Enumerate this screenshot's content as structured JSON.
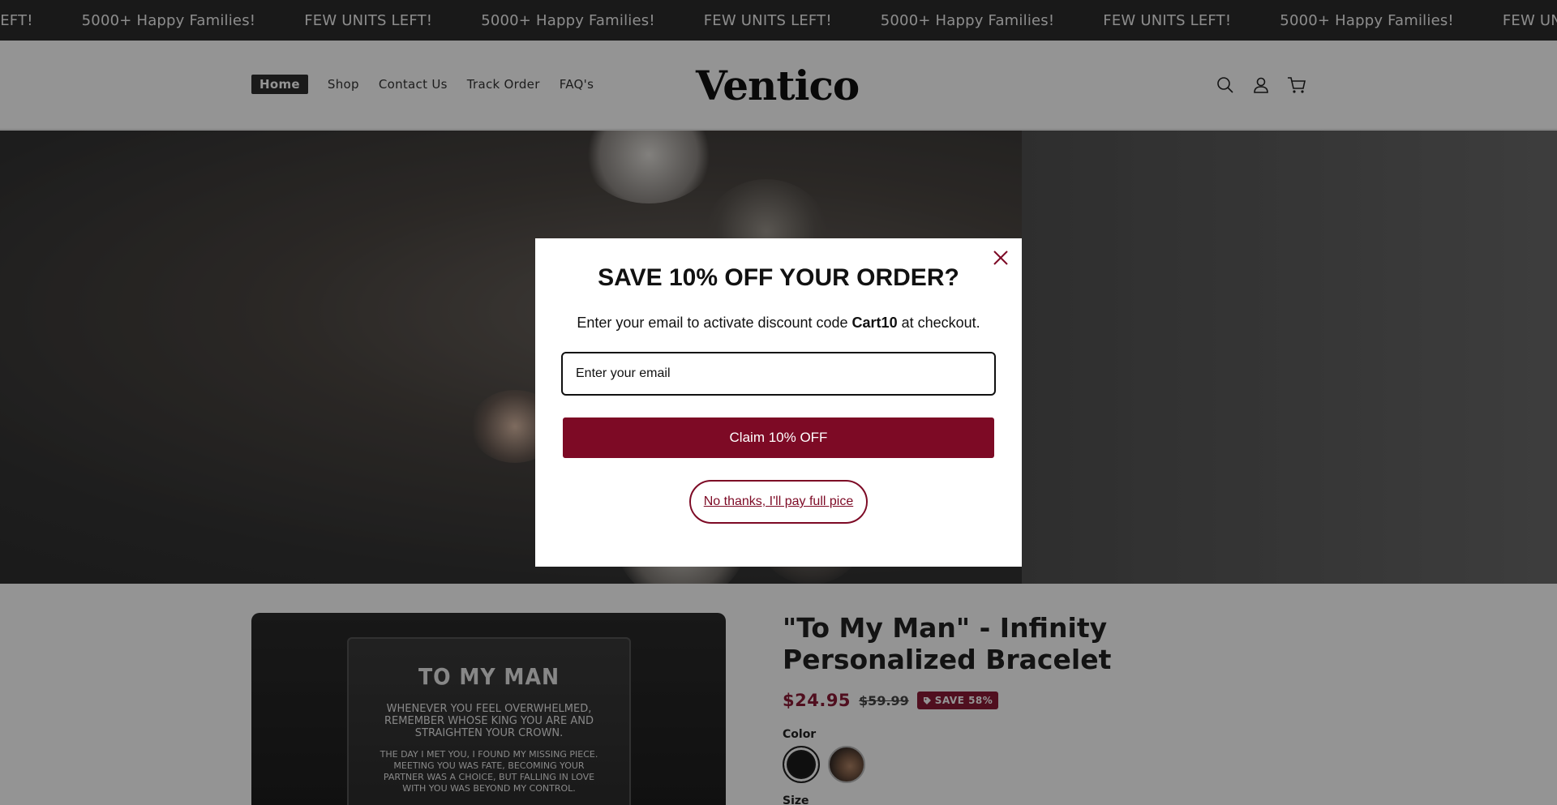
{
  "announcement": {
    "items": [
      "LEFT!",
      "5000+ Happy Families!",
      "FEW UNITS LEFT!",
      "5000+ Happy Families!",
      "FEW UNITS LEFT!",
      "5000+ Happy Families!",
      "FEW UNITS LEFT!",
      "5000+ Happy Families!",
      "FEW UNITS LEF"
    ]
  },
  "header": {
    "logo": "Ventico",
    "nav": [
      "Home",
      "Shop",
      "Contact Us",
      "Track Order",
      "FAQ's"
    ],
    "icons": [
      "search-icon",
      "account-icon",
      "cart-icon"
    ]
  },
  "modal": {
    "heading": "SAVE 10% OFF YOUR ORDER?",
    "sub_prefix": "Enter your email to activate discount code ",
    "sub_code": "Cart10",
    "sub_suffix": " at checkout.",
    "email_placeholder": "Enter your email",
    "claim_label": "Claim 10% OFF",
    "decline_label": "No thanks, I'll pay full pice"
  },
  "product": {
    "title": "\"To My Man\" - Infinity Personalized Bracelet",
    "price": "$24.95",
    "compare_price": "$59.99",
    "save_badge": "SAVE 58%",
    "color_label": "Color",
    "size_label": "Size",
    "card_title": "TO MY MAN",
    "card_text": "WHENEVER YOU FEEL OVERWHELMED, REMEMBER WHOSE KING YOU ARE AND STRAIGHTEN YOUR CROWN.",
    "card_text2": "THE DAY I MET YOU, I FOUND MY MISSING PIECE. MEETING YOU WAS FATE, BECOMING YOUR PARTNER WAS A CHOICE, BUT FALLING IN LOVE WITH YOU WAS BEYOND MY CONTROL."
  },
  "colors": {
    "accent": "#7d0a25",
    "price": "#8b1a36",
    "marquee_bg": "#2b2b2b"
  }
}
